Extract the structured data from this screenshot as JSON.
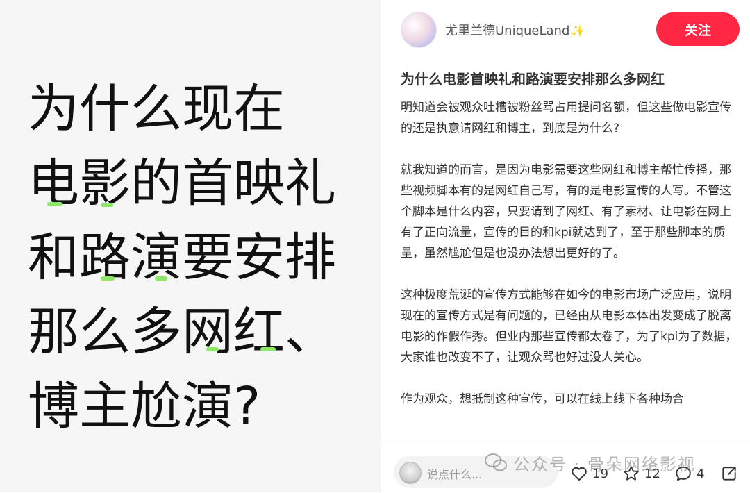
{
  "cover": {
    "lines": [
      "为什么现在",
      "电影的首映礼",
      "和路演要安排",
      "那么多网红、",
      "博主尬演?"
    ]
  },
  "post": {
    "author": "尤里兰德UniqueLand",
    "author_emoji": "✨",
    "follow_label": "关注",
    "title": "为什么电影首映礼和路演要安排那么多网红",
    "paragraphs": [
      "明知道会被观众吐槽被粉丝骂占用提问名额，但这些做电影宣传的还是执意请网红和博主，到底是为什么?",
      "就我知道的而言，是因为电影需要这些网红和博主帮忙传播，那些视频脚本有的是网红自己写，有的是电影宣传的人写。不管这个脚本是什么内容，只要请到了网红、有了素材、让电影在网上有了正向流量，宣传的目的和kpi就达到了，至于那些脚本的质量，虽然尴尬但是也没办法想出更好的了。",
      "这种极度荒诞的宣传方式能够在如今的电影市场广泛应用，说明现在的宣传方式是有问题的，已经由从电影本体出发变成了脱离电影的作假作秀。但业内那些宣传都太卷了，为了kpi为了数据，大家谁也改变不了，让观众骂也好过没人关心。",
      "作为观众，想抵制这种宣传，可以在线上线下各种场合"
    ]
  },
  "footer": {
    "comment_placeholder": "说点什么...",
    "likes": "19",
    "favorites": "12",
    "comments": "4"
  },
  "watermark": {
    "text": "公众号 · 骨朵网络影视"
  },
  "colors": {
    "accent": "#ff2744",
    "highlight_mark": "#8de86a"
  }
}
